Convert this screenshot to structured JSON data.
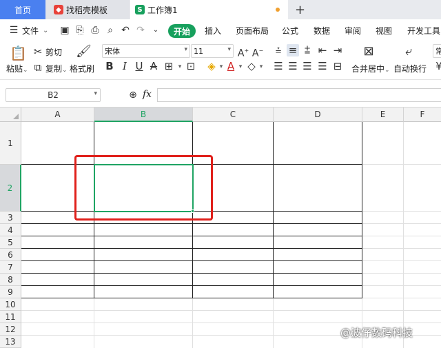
{
  "tabs": {
    "home": "首页",
    "template": "找稻壳模板",
    "workbook": "工作簿1",
    "new_tab": "+"
  },
  "menu": {
    "file": "文件",
    "start": "开始",
    "insert": "插入",
    "page_layout": "页面布局",
    "formula": "公式",
    "data": "数据",
    "review": "审阅",
    "view": "视图",
    "developer": "开发工具"
  },
  "ribbon": {
    "paste": "粘贴",
    "cut": "剪切",
    "copy": "复制",
    "format_painter": "格式刷",
    "font_name": "宋体",
    "font_size": "11",
    "merge_center": "合并居中",
    "wrap_text": "自动换行",
    "normal": "常"
  },
  "formula_bar": {
    "name_box": "B2",
    "fx": "fx"
  },
  "sheet": {
    "columns": [
      "A",
      "B",
      "C",
      "D",
      "E",
      "F"
    ],
    "rows": [
      "1",
      "2",
      "3",
      "4",
      "5",
      "6",
      "7",
      "8",
      "9",
      "10",
      "11",
      "12",
      "13"
    ],
    "active_cell": "B2"
  },
  "colors": {
    "tab_active": "#4a80f0",
    "start_green": "#17a05d",
    "selection_green": "#1fa463",
    "annotation_red": "#e0201b"
  },
  "watermark": "@波仔数码科技"
}
